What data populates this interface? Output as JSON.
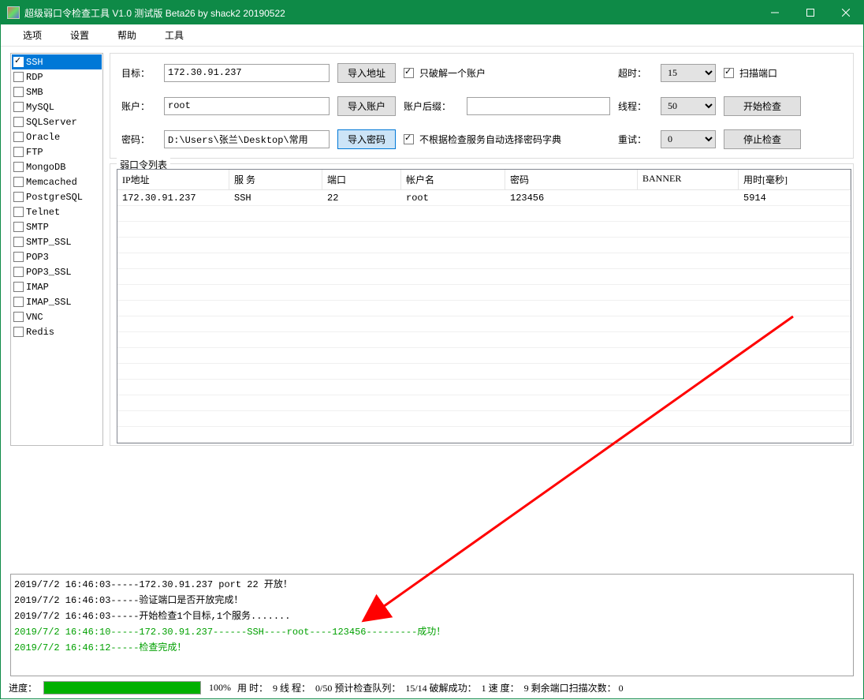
{
  "titlebar": {
    "title": "超级弱口令检查工具 V1.0 测试版 Beta26 by shack2 20190522"
  },
  "menu": [
    "选项",
    "设置",
    "帮助",
    "工具"
  ],
  "services": [
    {
      "name": "SSH",
      "checked": true,
      "selected": true
    },
    {
      "name": "RDP",
      "checked": false
    },
    {
      "name": "SMB",
      "checked": false
    },
    {
      "name": "MySQL",
      "checked": false
    },
    {
      "name": "SQLServer",
      "checked": false
    },
    {
      "name": "Oracle",
      "checked": false
    },
    {
      "name": "FTP",
      "checked": false
    },
    {
      "name": "MongoDB",
      "checked": false
    },
    {
      "name": "Memcached",
      "checked": false
    },
    {
      "name": "PostgreSQL",
      "checked": false
    },
    {
      "name": "Telnet",
      "checked": false
    },
    {
      "name": "SMTP",
      "checked": false
    },
    {
      "name": "SMTP_SSL",
      "checked": false
    },
    {
      "name": "POP3",
      "checked": false
    },
    {
      "name": "POP3_SSL",
      "checked": false
    },
    {
      "name": "IMAP",
      "checked": false
    },
    {
      "name": "IMAP_SSL",
      "checked": false
    },
    {
      "name": "VNC",
      "checked": false
    },
    {
      "name": "Redis",
      "checked": false
    }
  ],
  "form": {
    "target_label": "目标：",
    "target_value": "172.30.91.237",
    "import_addr": "导入地址",
    "only_one_label": "只破解一个账户",
    "only_one_checked": true,
    "timeout_label": "超时：",
    "timeout_value": "15",
    "scan_port_label": "扫描端口",
    "scan_port_checked": true,
    "user_label": "账户：",
    "user_value": "root",
    "import_user": "导入账户",
    "suffix_label": "账户后缀：",
    "suffix_value": "",
    "threads_label": "线程：",
    "threads_value": "50",
    "start_label": "开始检查",
    "pass_label": "密码：",
    "pass_value": "D:\\Users\\张兰\\Desktop\\常用",
    "import_pass": "导入密码",
    "noauto_label": "不根据检查服务自动选择密码字典",
    "noauto_checked": true,
    "retry_label": "重试：",
    "retry_value": "0",
    "stop_label": "停止检查"
  },
  "result": {
    "legend": "弱口令列表",
    "headers": {
      "ip": "IP地址",
      "svc": "服 务",
      "port": "端口",
      "user": "帐户名",
      "pass": "密码",
      "banner": "BANNER",
      "time": "用时[毫秒]"
    },
    "rows": [
      {
        "ip": "172.30.91.237",
        "svc": "SSH",
        "port": "22",
        "user": "root",
        "pass": "123456",
        "banner": "",
        "time": "5914"
      }
    ]
  },
  "log": [
    {
      "text": "2019/7/2 16:46:03-----172.30.91.237 port 22 开放！",
      "cls": ""
    },
    {
      "text": "2019/7/2 16:46:03-----验证端口是否开放完成！",
      "cls": ""
    },
    {
      "text": "2019/7/2 16:46:03-----开始检查1个目标,1个服务.......",
      "cls": ""
    },
    {
      "text": "2019/7/2 16:46:10-----172.30.91.237------SSH----root----123456---------成功！",
      "cls": "log-green"
    },
    {
      "text": "2019/7/2 16:46:12-----检查完成！",
      "cls": "log-green"
    }
  ],
  "status": {
    "progress_label": "进度：",
    "progress_pct": 100,
    "pct_text": "100%",
    "text": "用 时：  9 线 程：  0/50 预计检查队列：  15/14 破解成功：  1 速 度：  9 剩余端口扫描次数： 0"
  }
}
